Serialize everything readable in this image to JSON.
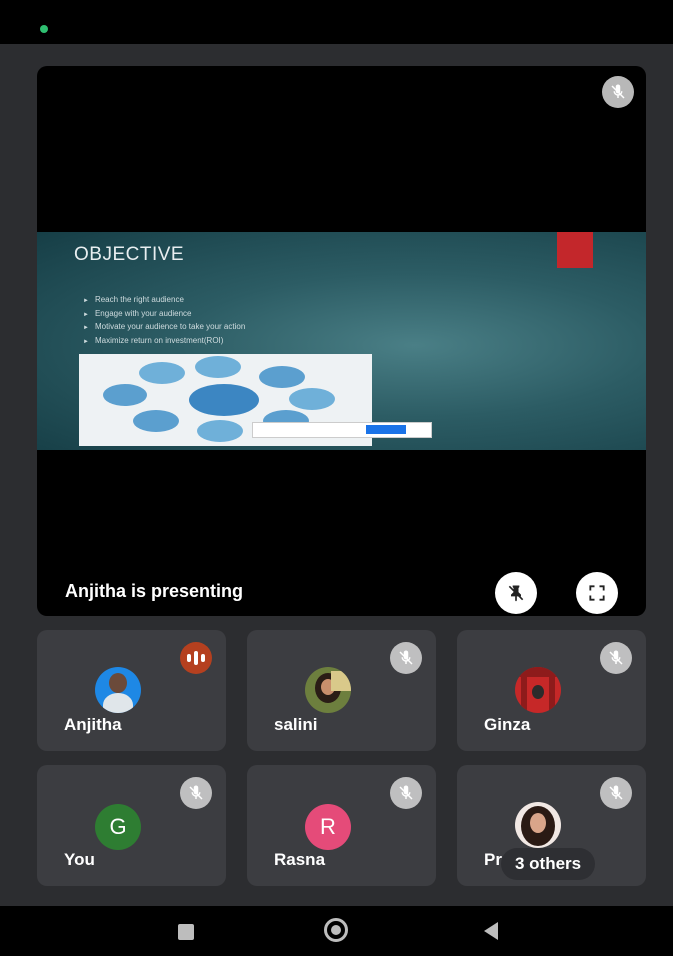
{
  "colors": {
    "status_dot": "#2fbf71",
    "speaking_indicator": "#b5401f",
    "avatar_g": "#2e7d32",
    "avatar_r": "#e54b79"
  },
  "stage": {
    "presenting_label": "Anjitha is presenting",
    "mic_state": "muted",
    "controls": [
      {
        "name": "unpin-presentation",
        "icon": "pin-off-icon"
      },
      {
        "name": "fullscreen",
        "icon": "fullscreen-icon"
      }
    ]
  },
  "slide": {
    "title": "OBJECTIVE",
    "bullets": [
      "Reach the right audience",
      "Engage with your audience",
      "Motivate your audience to take your action",
      "Maximize return on investment(ROI)"
    ]
  },
  "participants": [
    {
      "name": "Anjitha",
      "state": "speaking",
      "avatar": "photo"
    },
    {
      "name": "salini",
      "state": "muted",
      "avatar": "photo"
    },
    {
      "name": "Ginza",
      "state": "muted",
      "avatar": "photo"
    },
    {
      "name": "You",
      "state": "muted",
      "avatar": "letter",
      "letter": "G"
    },
    {
      "name": "Rasna",
      "state": "muted",
      "avatar": "letter",
      "letter": "R"
    },
    {
      "name": "Pr",
      "state": "muted",
      "avatar": "photo",
      "others_label": "3 others"
    }
  ],
  "nav": {
    "buttons": [
      "recents-button",
      "home-button",
      "back-button"
    ]
  }
}
